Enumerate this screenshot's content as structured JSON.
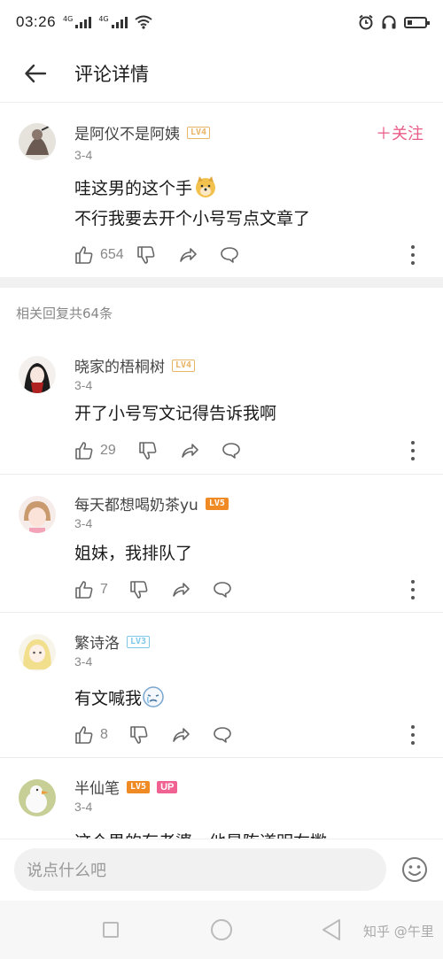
{
  "status_bar": {
    "time": "03:26",
    "net1": "4G",
    "net2": "4G"
  },
  "header": {
    "title": "评论详情"
  },
  "main_comment": {
    "user": "是阿仪不是阿姨",
    "level": "LV4",
    "date": "3-4",
    "follow": "关注",
    "text_line1": "哇这男的这个手",
    "text_line2": "不行我要去开个小号写点文章了",
    "likes": "654"
  },
  "reply_count": "相关回复共64条",
  "replies": [
    {
      "user": "晓家的梧桐树",
      "level": "LV4",
      "date": "3-4",
      "text": "开了小号写文记得告诉我啊",
      "likes": "29"
    },
    {
      "user": "每天都想喝奶茶yu",
      "level": "LV5",
      "date": "3-4",
      "text": "姐妹，我排队了",
      "likes": "7"
    },
    {
      "user": "繁诗洛",
      "level": "LV3",
      "date": "3-4",
      "text": "有文喊我",
      "likes": "8"
    },
    {
      "user": "半仙笔",
      "level": "LV5",
      "badge": "UP",
      "date": "3-4",
      "text": "这个男的有老婆，他是陈道明右撇"
    }
  ],
  "input": {
    "placeholder": "说点什么吧"
  },
  "watermark": "知乎 @午里",
  "colors": {
    "accent": "#e95b86",
    "lv4": "#e8b466",
    "lv5": "#f08a24",
    "lv3": "#7fc7e8"
  }
}
